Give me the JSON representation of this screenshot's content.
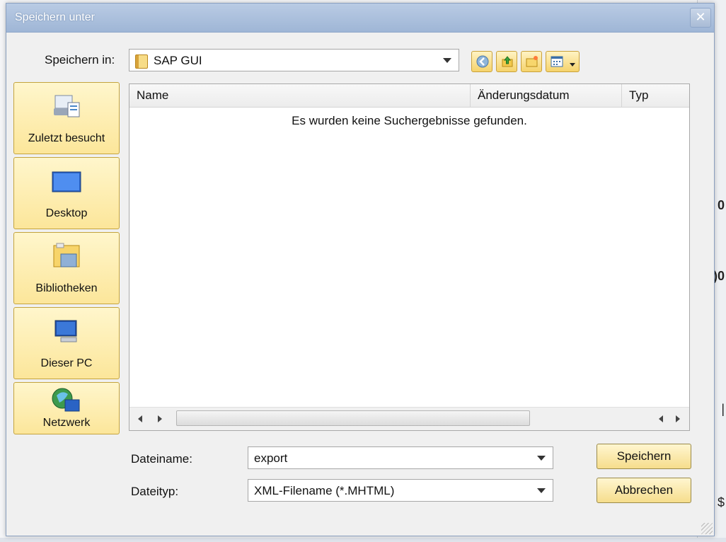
{
  "dialog": {
    "title": "Speichern unter",
    "close_glyph": "✕"
  },
  "save_in": {
    "label": "Speichern in:",
    "value": "SAP GUI"
  },
  "toolbar": {
    "icons": [
      "back-icon",
      "up-folder-icon",
      "new-folder-icon",
      "view-menu-icon"
    ]
  },
  "places": [
    {
      "label": "Zuletzt besucht",
      "icon": "recent-icon"
    },
    {
      "label": "Desktop",
      "icon": "desktop-icon"
    },
    {
      "label": "Bibliotheken",
      "icon": "libraries-icon"
    },
    {
      "label": "Dieser PC",
      "icon": "computer-icon"
    },
    {
      "label": "Netzwerk",
      "icon": "network-icon"
    }
  ],
  "filelist": {
    "columns": [
      "Name",
      "Änderungsdatum",
      "Typ"
    ],
    "empty_message": "Es wurden keine Suchergebnisse gefunden."
  },
  "filename": {
    "label": "Dateiname:",
    "value": "export"
  },
  "filetype": {
    "label": "Dateityp:",
    "value": "XML-Filename (*.MHTML)"
  },
  "buttons": {
    "save": "Speichern",
    "cancel": "Abbrechen"
  },
  "background": {
    "chars": [
      "0",
      ")0",
      "|",
      "$"
    ]
  }
}
